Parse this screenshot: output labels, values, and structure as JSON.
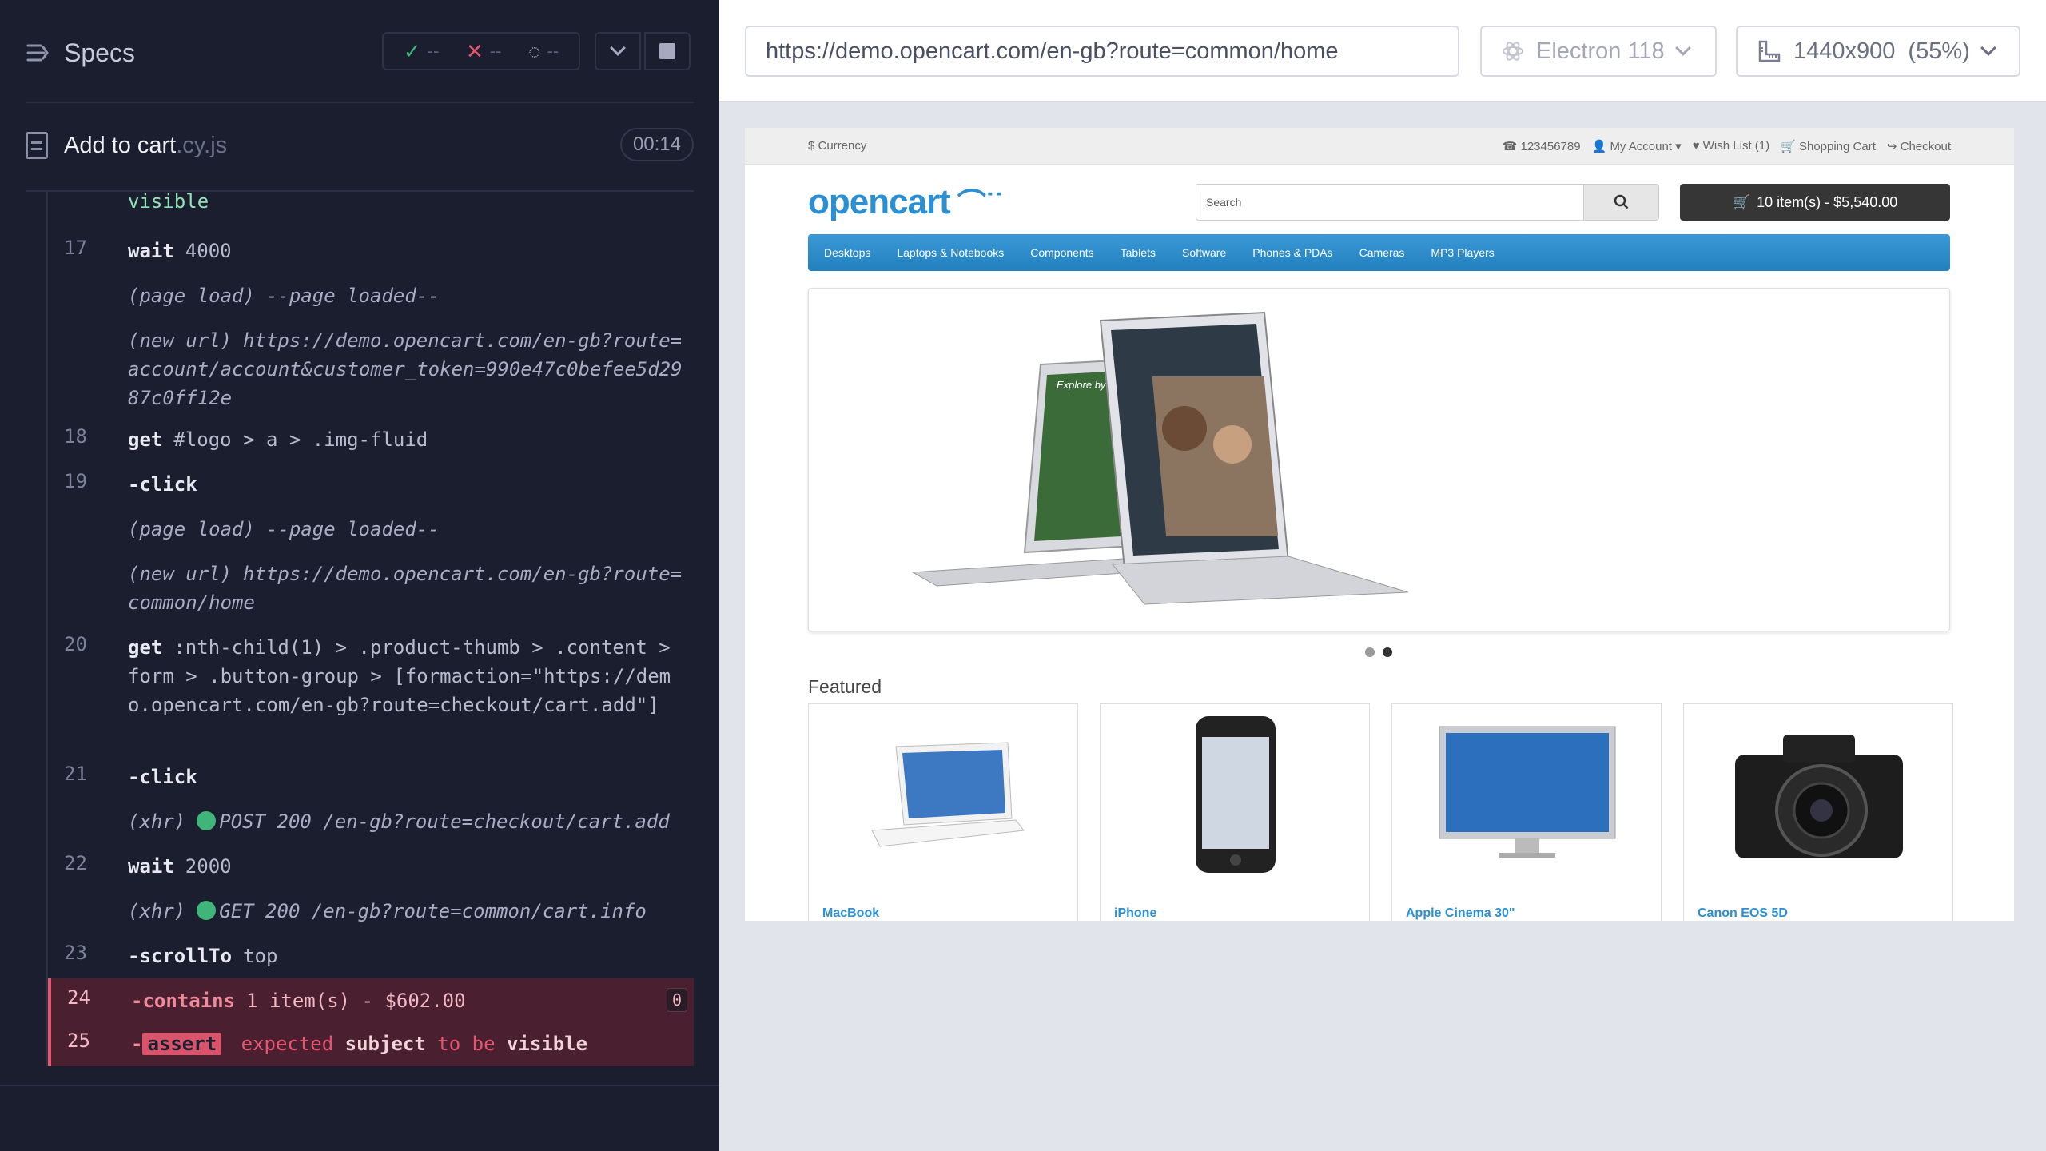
{
  "reporter": {
    "title": "Specs",
    "stats": {
      "passed": "--",
      "failed": "--",
      "pending": "--"
    },
    "spec": {
      "name": "Add to cart",
      "ext": ".cy.js",
      "time": "00:14"
    },
    "truncated_line": "visible",
    "commands": [
      {
        "num": "17",
        "name": "wait",
        "arg": "4000"
      },
      {
        "label": "(page load)",
        "text": "--page loaded--"
      },
      {
        "label": "(new url)",
        "text": "https://demo.opencart.com/en-gb?route=account/account&customer_token=990e47c0befee5d2987c0ff12e"
      },
      {
        "num": "18",
        "name": "get",
        "arg": "#logo > a > .img-fluid"
      },
      {
        "num": "19",
        "name": "-click",
        "arg": ""
      },
      {
        "label": "(page load)",
        "text": "--page loaded--"
      },
      {
        "label": "(new url)",
        "text": "https://demo.opencart.com/en-gb?route=common/home"
      },
      {
        "num": "20",
        "name": "get",
        "arg": ":nth-child(1) > .product-thumb > .content > form > .button-group > [formaction=\"https://demo.opencart.com/en-gb?route=checkout/cart.add\"]"
      },
      {
        "num": "21",
        "name": "-click",
        "arg": ""
      },
      {
        "label": "(xhr)",
        "text": "POST 200 /en-gb?route=checkout/cart.add"
      },
      {
        "num": "22",
        "name": "wait",
        "arg": "2000"
      },
      {
        "label": "(xhr)",
        "text": "GET 200 /en-gb?route=common/cart.info"
      },
      {
        "num": "23",
        "name": "-scrollTo",
        "arg": "top"
      },
      {
        "num": "24",
        "name": "-contains",
        "arg": "1 item(s) - $602.00",
        "badge": "0"
      },
      {
        "num": "25",
        "name": "-",
        "assert": "assert",
        "w1": "expected",
        "w2": "subject",
        "w3": "to be",
        "w4": "visible"
      }
    ]
  },
  "aut": {
    "url": "https://demo.opencart.com/en-gb?route=common/home",
    "browser": "Electron 118",
    "viewport": "1440x900",
    "scale": "(55%)"
  },
  "site": {
    "currency": "$ Currency",
    "toplinks": [
      "123456789",
      "My Account",
      "Wish List (1)",
      "Shopping Cart",
      "Checkout"
    ],
    "logo": "opencart",
    "search_placeholder": "Search",
    "cart_button": "10 item(s) - $5,540.00",
    "menu": [
      "Desktops",
      "Laptops & Notebooks",
      "Components",
      "Tablets",
      "Software",
      "Phones & PDAs",
      "Cameras",
      "MP3 Players"
    ],
    "slide_caption": "Explore by land.",
    "featured_title": "Featured",
    "products": [
      "MacBook",
      "iPhone",
      "Apple Cinema 30\"",
      "Canon EOS 5D"
    ]
  },
  "colors": {
    "accent_blue": "#2b8fd4",
    "pass_green": "#3fb57a",
    "fail_red": "#e45770",
    "reporter_bg": "#1b1e2e"
  }
}
